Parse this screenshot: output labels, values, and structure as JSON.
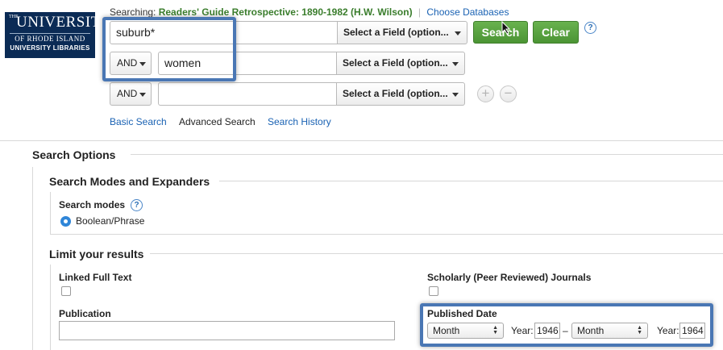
{
  "logo": {
    "the": "THE",
    "university": "UNIVERSITY",
    "of_ri": "OF RHODE ISLAND",
    "libraries": "UNIVERSITY LIBRARIES"
  },
  "header": {
    "searching_label": "Searching:",
    "database": "Readers' Guide Retrospective: 1890-1982 (H.W. Wilson)",
    "separator": "|",
    "choose_databases": "Choose Databases"
  },
  "search_rows": [
    {
      "bool": "",
      "value": "suburb*",
      "field": "Select a Field (option..."
    },
    {
      "bool": "AND",
      "value": "women",
      "field": "Select a Field (option..."
    },
    {
      "bool": "AND",
      "value": "",
      "field": "Select a Field (option..."
    }
  ],
  "buttons": {
    "search": "Search",
    "clear": "Clear",
    "help": "?",
    "add": "+",
    "remove": "−"
  },
  "nav": {
    "basic": "Basic Search",
    "advanced": "Advanced Search",
    "history": "Search History"
  },
  "options": {
    "title": "Search Options",
    "modes_section": "Search Modes and Expanders",
    "modes_label": "Search modes",
    "modes_value": "Boolean/Phrase",
    "limit_section": "Limit your results",
    "linked_full_text": "Linked Full Text",
    "scholarly": "Scholarly (Peer Reviewed) Journals",
    "publication": "Publication",
    "published_date": "Published Date",
    "from_month": "Month",
    "year_label": "Year:",
    "from_year": "1946",
    "dash": "–",
    "to_month": "Month",
    "to_year": "1964"
  },
  "colors": {
    "accent_green": "#4b9434",
    "link_blue": "#1a62b3",
    "highlight_blue": "#4a77b4",
    "logo_navy": "#0b2b55"
  }
}
